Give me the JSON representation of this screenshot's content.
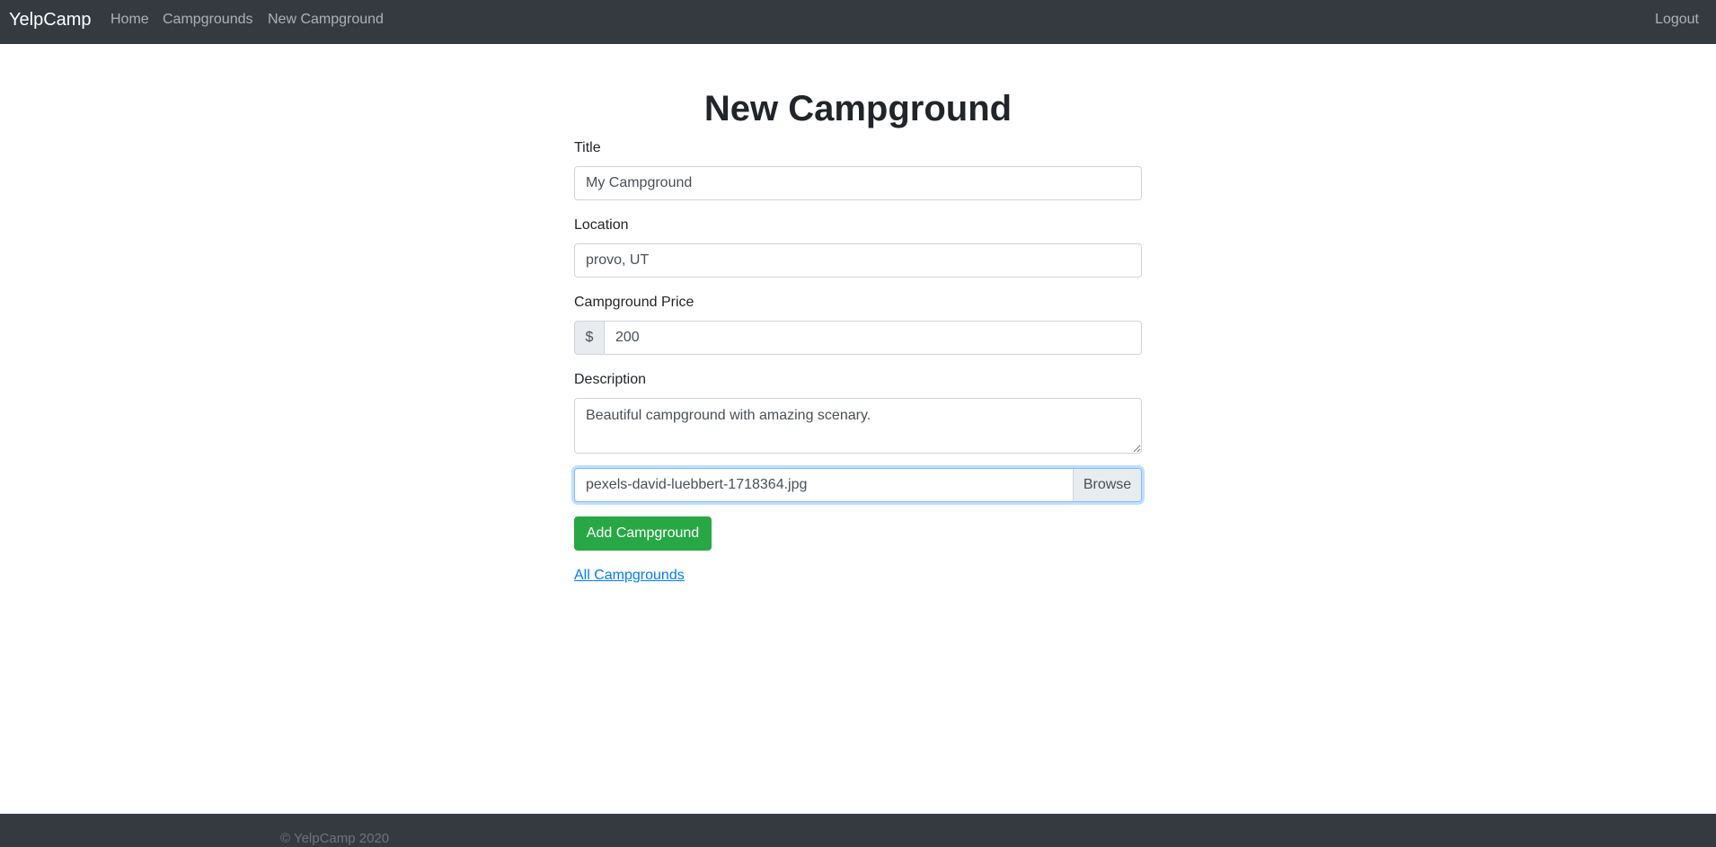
{
  "navbar": {
    "brand": "YelpCamp",
    "links": {
      "home": "Home",
      "campgrounds": "Campgrounds",
      "new_campground": "New Campground"
    },
    "logout": "Logout"
  },
  "main": {
    "heading": "New Campground",
    "form": {
      "title": {
        "label": "Title",
        "value": "My Campground"
      },
      "location": {
        "label": "Location",
        "value": "provo, UT"
      },
      "price": {
        "label": "Campground Price",
        "prefix": "$",
        "value": "200"
      },
      "description": {
        "label": "Description",
        "value": "Beautiful campground with amazing scenary."
      },
      "image": {
        "file_name": "pexels-david-luebbert-1718364.jpg",
        "browse_label": "Browse"
      },
      "submit_label": "Add Campground"
    },
    "back_link": "All Campgrounds"
  },
  "footer": {
    "text": "© YelpCamp 2020"
  },
  "colors": {
    "navbar_bg": "#343a40",
    "submit_green": "#28a745",
    "link_blue": "#007bff",
    "focus_border": "#80bdff"
  }
}
